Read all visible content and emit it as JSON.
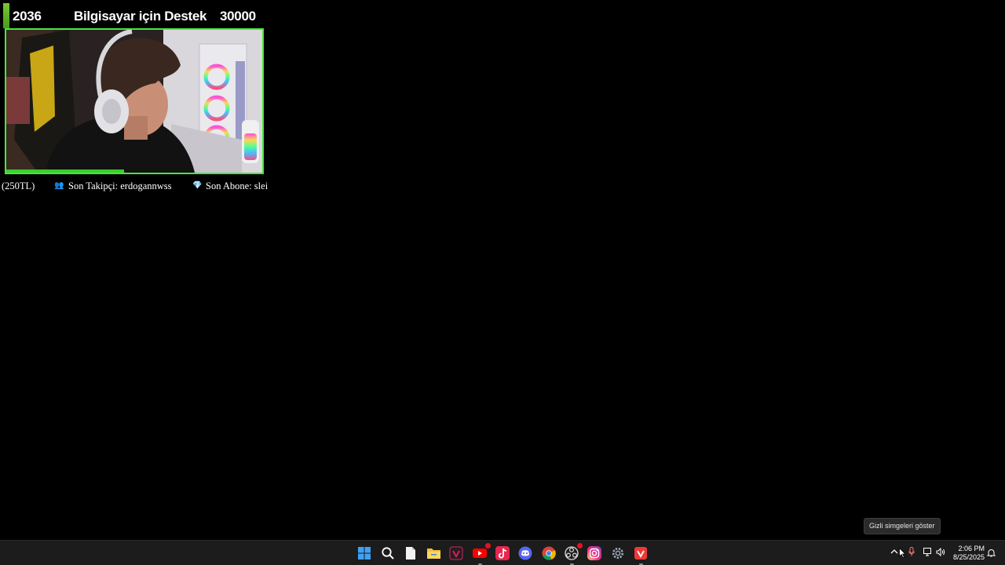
{
  "stream_overlay": {
    "goal": {
      "current": "2036",
      "title": "Bilgisayar için Destek",
      "target": "30000",
      "progress": 0.068,
      "fill_color": "#5fb82a"
    },
    "webcam": {
      "border_color": "#48e83a"
    },
    "ticker": {
      "amount": "(250TL)",
      "follower_icon": "people-icon",
      "follower": "Son Takipçi: erdogannwss",
      "subscriber_icon": "gem-icon",
      "subscriber": "Son Abone: slei"
    }
  },
  "tooltip": {
    "text": "Gizli simgeleri göster"
  },
  "taskbar": {
    "apps": [
      {
        "name": "start-button",
        "icon": "windows-icon"
      },
      {
        "name": "search-button",
        "icon": "search-icon"
      },
      {
        "name": "notepad-app",
        "icon": "document-icon"
      },
      {
        "name": "file-explorer-app",
        "icon": "folder-icon"
      },
      {
        "name": "vivaldi-app",
        "icon": "vivaldi-icon"
      },
      {
        "name": "youtube-app",
        "icon": "youtube-icon"
      },
      {
        "name": "tiktok-app",
        "icon": "tiktok-icon"
      },
      {
        "name": "discord-app",
        "icon": "discord-icon"
      },
      {
        "name": "chrome-app",
        "icon": "chrome-icon"
      },
      {
        "name": "obs-app",
        "icon": "obs-icon"
      },
      {
        "name": "instagram-app",
        "icon": "instagram-icon"
      },
      {
        "name": "settings-app",
        "icon": "gear-icon"
      },
      {
        "name": "vivaldi-red-app",
        "icon": "vivaldi-icon"
      }
    ],
    "tray": {
      "chevron_icon": "chevron-up-icon",
      "mic_icon": "microphone-icon",
      "network_icon": "network-icon",
      "volume_icon": "volume-icon",
      "notification_icon": "notification-icon"
    },
    "clock": {
      "time": "2:06 PM",
      "date": "8/25/2025"
    }
  }
}
